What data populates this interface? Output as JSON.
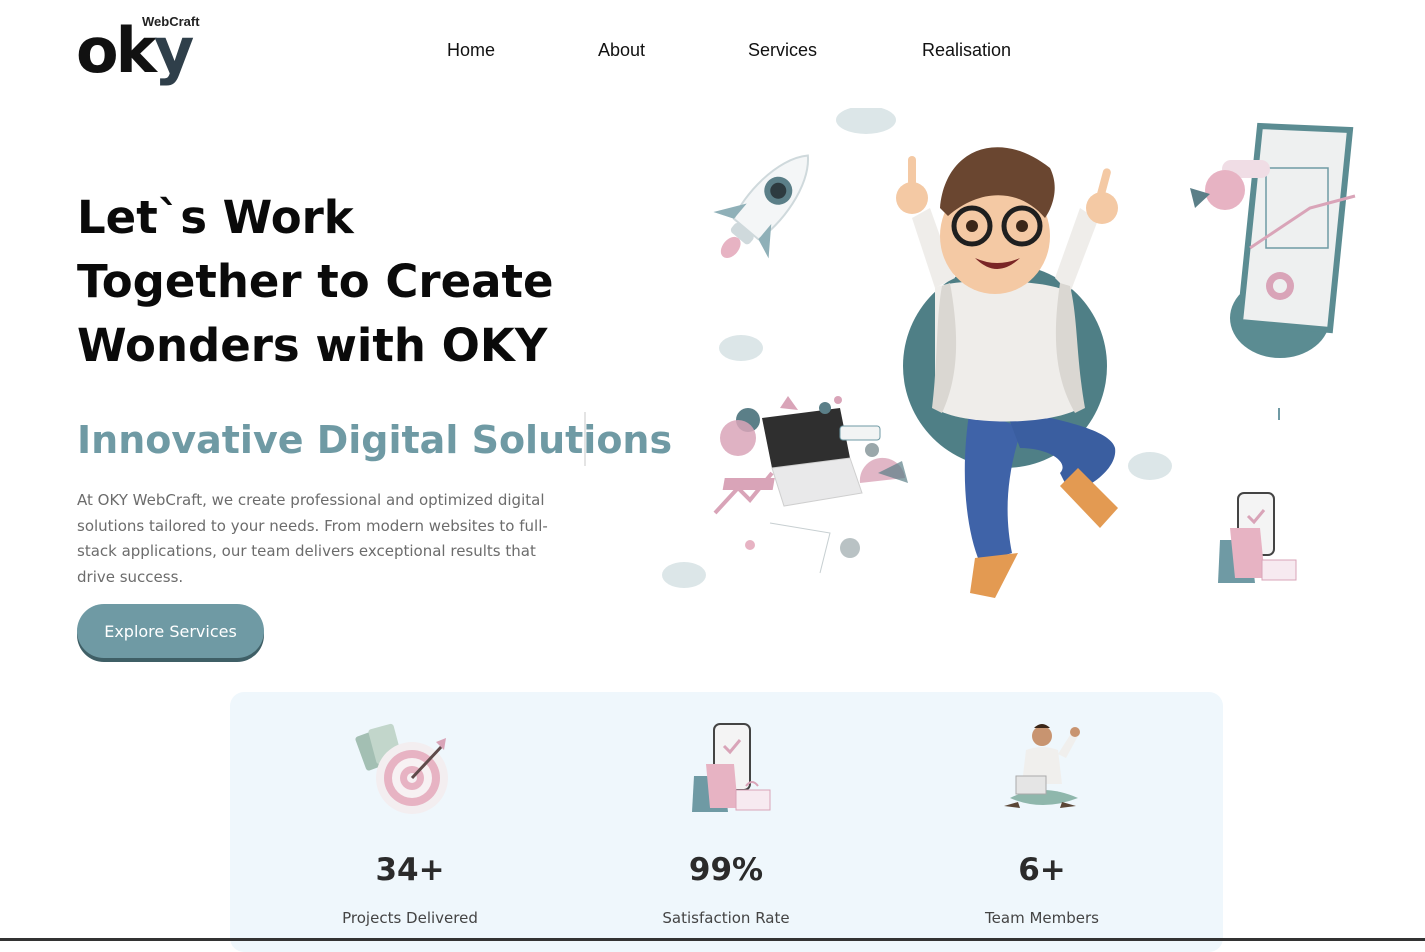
{
  "header": {
    "logo": {
      "brand": "oky",
      "sub": "WebCraft"
    },
    "nav": [
      {
        "label": "Home"
      },
      {
        "label": "About"
      },
      {
        "label": "Services"
      },
      {
        "label": "Realisation"
      }
    ]
  },
  "hero": {
    "title_lines": [
      "Let`s Work",
      "Together to Create",
      "Wonders with OKY"
    ],
    "subtitle": "Innovative Digital Solutions",
    "description": "At OKY WebCraft, we create professional and optimized digital solutions tailored to your needs. From modern websites to full-stack applications, our team delivers exceptional results that drive success.",
    "cta_label": "Explore Services"
  },
  "stats": [
    {
      "value": "34+",
      "label": "Projects Delivered",
      "icon": "target-icon"
    },
    {
      "value": "99%",
      "label": "Satisfaction Rate",
      "icon": "phone-shopping-icon"
    },
    {
      "value": "6+",
      "label": "Team Members",
      "icon": "person-laptop-icon"
    }
  ],
  "colors": {
    "accent": "#6f9aa4",
    "accent_dark": "#3f5f66",
    "stats_bg": "#eff7fc",
    "pink": "#d9a4b8"
  }
}
